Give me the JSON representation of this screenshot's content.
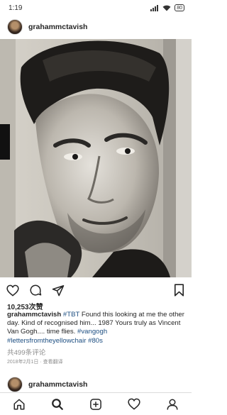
{
  "status_bar": {
    "time": "1:19",
    "battery": "80",
    "icons": [
      "signal-icon",
      "wifi-icon",
      "battery-icon"
    ]
  },
  "post": {
    "username": "grahammctavish",
    "likes": "10,253次赞",
    "caption": {
      "user": "grahammctavish",
      "parts": [
        {
          "type": "tag",
          "text": "#TBT"
        },
        {
          "type": "text",
          "text": " Found this looking at me the other day. Kind of recognised him... 1987 Yours truly as Vincent Van Gogh.... time flies. "
        },
        {
          "type": "tag",
          "text": "#vangogh"
        },
        {
          "type": "text",
          "text": " "
        },
        {
          "type": "tag",
          "text": "#lettersfromtheyellowchair"
        },
        {
          "type": "text",
          "text": " "
        },
        {
          "type": "tag",
          "text": "#80s"
        }
      ]
    },
    "comments": "共499条评论",
    "date": "2018年2月1日 · 查看翻译",
    "actions": [
      "heart-icon",
      "comment-icon",
      "share-icon",
      "bookmark-icon"
    ]
  },
  "next_post": {
    "username": "grahammctavish"
  },
  "bottom_nav": [
    "home-icon",
    "search-icon",
    "add-post-icon",
    "activity-heart-icon",
    "profile-icon"
  ],
  "colors": {
    "text": "#262626",
    "secondary": "#8e8e8e",
    "link": "#1e4f82",
    "divider": "#dbdbdb"
  }
}
